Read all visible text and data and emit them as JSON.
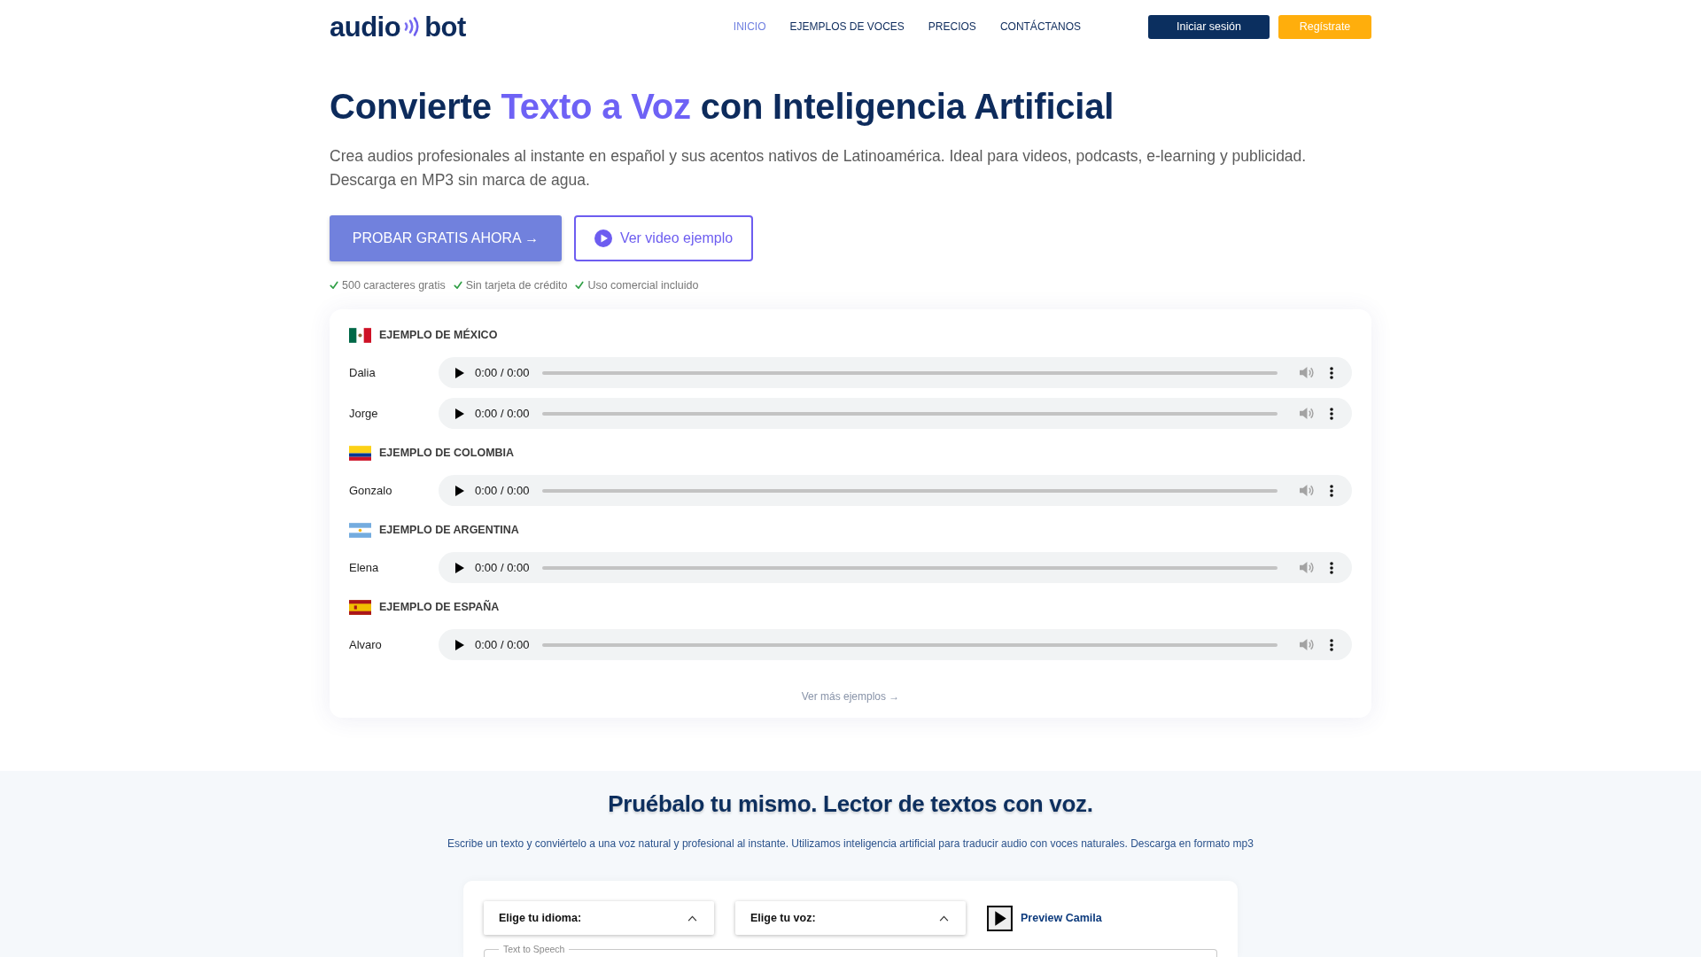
{
  "header": {
    "logo": {
      "left": "audio",
      "right": "bot"
    },
    "nav": [
      {
        "label": "INICIO",
        "selected": true
      },
      {
        "label": "EJEMPLOS DE VOCES",
        "selected": false
      },
      {
        "label": "PRECIOS",
        "selected": false
      },
      {
        "label": "CONTÁCTANOS",
        "selected": false
      }
    ],
    "buttons": [
      {
        "label": "Iniciar sesión",
        "kind": "login"
      },
      {
        "label": "Regístrate",
        "kind": "signup"
      }
    ]
  },
  "hero": {
    "title": [
      {
        "text": "Convierte ",
        "highlight": false
      },
      {
        "text": "Texto a Voz",
        "highlight": true
      },
      {
        "text": " con Inteligencia Artificial",
        "highlight": false
      }
    ],
    "subtitle": "Crea audios profesionales al instante en español y sus acentos nativos de Latinoamérica. Ideal para videos, podcasts, e-learning y publicidad. Descarga en MP3 sin marca de agua.",
    "buttons": [
      {
        "label": "PROBAR GRATIS AHORA →",
        "kind": "primary"
      },
      {
        "label": "Ver video ejemplo",
        "kind": "video"
      }
    ],
    "perks": [
      "500 caracteres gratis",
      "Sin tarjeta de crédito",
      "Uso comercial incluido"
    ]
  },
  "examples": {
    "sections": [
      {
        "title": "EJEMPLO DE MÉXICO",
        "kind": "mexico",
        "voices": [
          {
            "name": "Dalia",
            "time": "0:00 / 0:00"
          },
          {
            "name": "Jorge",
            "time": "0:00 / 0:00"
          }
        ]
      },
      {
        "title": "EJEMPLO DE COLOMBIA",
        "kind": "colombia",
        "voices": [
          {
            "name": "Gonzalo",
            "time": "0:00 / 0:00"
          }
        ]
      },
      {
        "title": "EJEMPLO DE ARGENTINA",
        "kind": "argentina",
        "voices": [
          {
            "name": "Elena",
            "time": "0:00 / 0:00"
          }
        ]
      },
      {
        "title": "EJEMPLO DE ESPAÑA",
        "kind": "spain",
        "voices": [
          {
            "name": "Alvaro",
            "time": "0:00 / 0:00"
          }
        ]
      }
    ],
    "more_link": "Ver más ejemplos →"
  },
  "demo": {
    "title": "Pruébalo tu mismo. Lector de textos con voz.",
    "description": "Escribe un texto y conviértelo a una voz natural y profesional al instante. Utilizamos inteligencia artificial para traducir audio con voces naturales. Descarga en formato mp3",
    "selects": [
      {
        "label": "Elige tu idioma:"
      },
      {
        "label": "Elige tu voz:"
      }
    ],
    "preview": {
      "label": "Preview Camila"
    },
    "text_box": {
      "legend": "Text to Speech"
    }
  }
}
